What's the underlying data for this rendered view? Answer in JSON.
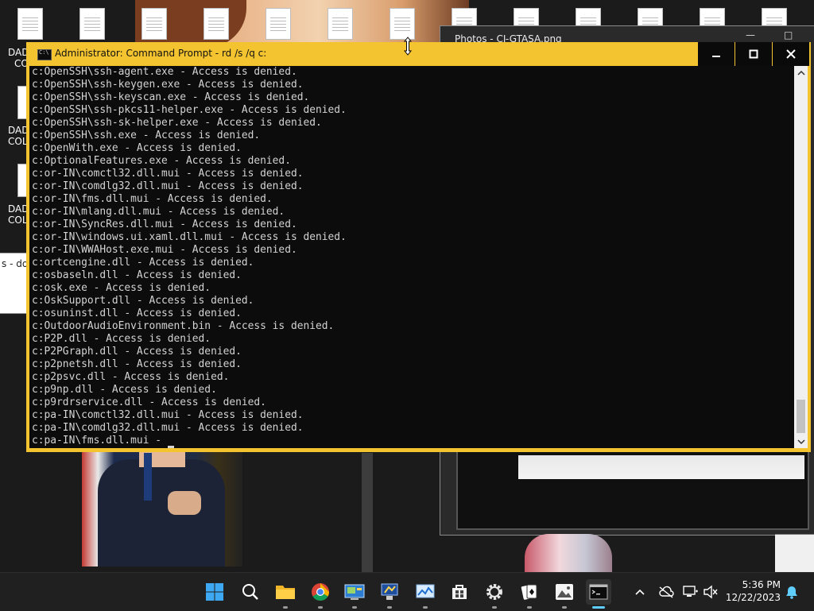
{
  "desktop": {
    "left_labels": [
      "DAD",
      "CO",
      "DAD",
      "COL",
      "DAD",
      "COL"
    ],
    "browser_tab_label": "s - dov",
    "photos_window_title": "Photos - CJ-GTASA.png"
  },
  "cmd": {
    "title": "Administrator: Command Prompt - rd  /s /q c:",
    "icon": "cmd-icon",
    "controls": {
      "minimize_icon": "minimize-icon",
      "maximize_icon": "maximize-icon",
      "close_icon": "close-icon"
    },
    "lines": [
      "c:OpenSSH\\ssh-agent.exe - Access is denied.",
      "c:OpenSSH\\ssh-keygen.exe - Access is denied.",
      "c:OpenSSH\\ssh-keyscan.exe - Access is denied.",
      "c:OpenSSH\\ssh-pkcs11-helper.exe - Access is denied.",
      "c:OpenSSH\\ssh-sk-helper.exe - Access is denied.",
      "c:OpenSSH\\ssh.exe - Access is denied.",
      "c:OpenWith.exe - Access is denied.",
      "c:OptionalFeatures.exe - Access is denied.",
      "c:or-IN\\comctl32.dll.mui - Access is denied.",
      "c:or-IN\\comdlg32.dll.mui - Access is denied.",
      "c:or-IN\\fms.dll.mui - Access is denied.",
      "c:or-IN\\mlang.dll.mui - Access is denied.",
      "c:or-IN\\SyncRes.dll.mui - Access is denied.",
      "c:or-IN\\windows.ui.xaml.dll.mui - Access is denied.",
      "c:or-IN\\WWAHost.exe.mui - Access is denied.",
      "c:ortcengine.dll - Access is denied.",
      "c:osbaseln.dll - Access is denied.",
      "c:osk.exe - Access is denied.",
      "c:OskSupport.dll - Access is denied.",
      "c:osuninst.dll - Access is denied.",
      "c:OutdoorAudioEnvironment.bin - Access is denied.",
      "c:P2P.dll - Access is denied.",
      "c:P2PGraph.dll - Access is denied.",
      "c:p2pnetsh.dll - Access is denied.",
      "c:p2psvc.dll - Access is denied.",
      "c:p9np.dll - Access is denied.",
      "c:p9rdrservice.dll - Access is denied.",
      "c:pa-IN\\comctl32.dll.mui - Access is denied.",
      "c:pa-IN\\comdlg32.dll.mui - Access is denied."
    ],
    "current_line": "c:pa-IN\\fms.dll.mui - "
  },
  "taskbar": {
    "apps": [
      {
        "name": "start-button",
        "icon": "windows-logo-icon"
      },
      {
        "name": "search-button",
        "icon": "search-icon"
      },
      {
        "name": "file-explorer",
        "icon": "folder-icon"
      },
      {
        "name": "chrome",
        "icon": "chrome-icon"
      },
      {
        "name": "control-panel",
        "icon": "control-panel-icon"
      },
      {
        "name": "system-app",
        "icon": "computer-icon"
      },
      {
        "name": "resource-monitor",
        "icon": "monitor-chart-icon"
      },
      {
        "name": "microsoft-store",
        "icon": "store-icon"
      },
      {
        "name": "settings",
        "icon": "gear-icon"
      },
      {
        "name": "solitaire",
        "icon": "cards-icon"
      },
      {
        "name": "photos",
        "icon": "photos-icon"
      },
      {
        "name": "command-prompt",
        "icon": "terminal-icon"
      }
    ],
    "tray": {
      "chevron_icon": "chevron-up-icon",
      "onedrive_icon": "cloud-off-icon",
      "network_icon": "network-icon",
      "volume_icon": "volume-muted-icon",
      "time": "5:36 PM",
      "date": "12/22/2023",
      "notification_icon": "bell-icon",
      "accent_color": "#60cdff"
    }
  },
  "colors": {
    "cmd_frame": "#f4c430",
    "console_bg": "#0c0c0c",
    "console_text": "#d4d4d4"
  }
}
